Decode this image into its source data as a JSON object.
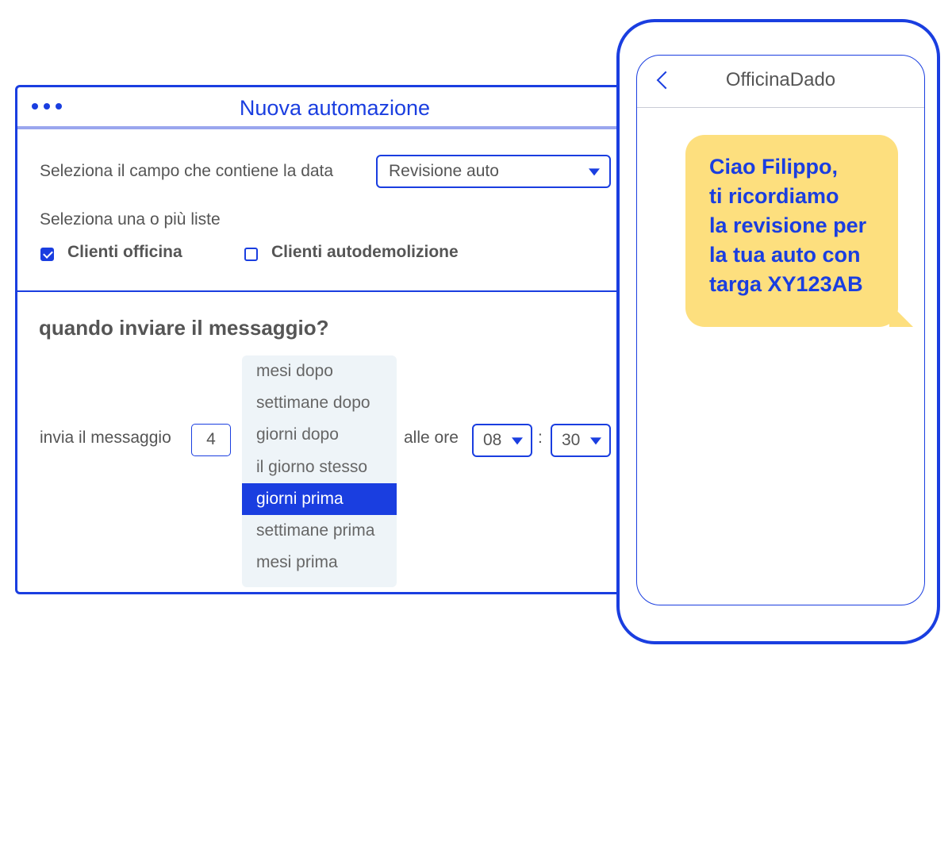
{
  "window": {
    "title": "Nuova automazione",
    "date_field_label": "Seleziona il campo che contiene la data",
    "date_field_value": "Revisione auto",
    "lists_label": "Seleziona una o più liste",
    "lists": [
      {
        "label": "Clienti officina",
        "checked": true
      },
      {
        "label": "Clienti autodemolizione",
        "checked": false
      }
    ],
    "section_title": "quando inviare il messaggio?",
    "send_label": "invia il messaggio",
    "send_amount": "4",
    "timing_options": [
      "mesi dopo",
      "settimane dopo",
      "giorni dopo",
      "il giorno stesso",
      "giorni prima",
      "settimane prima",
      "mesi prima"
    ],
    "timing_selected": "giorni prima",
    "time_label": "alle ore",
    "hour": "08",
    "separator": ":",
    "minute": "30"
  },
  "phone": {
    "sender": "OfficinaDado",
    "message_lines": [
      "Ciao Filippo,",
      "ti ricordiamo",
      "la revisione per",
      "la tua auto con",
      "targa XY123AB"
    ]
  },
  "colors": {
    "accent": "#1a3ee0",
    "bubble": "#fddf7e",
    "dropdown_bg": "#eef4f8"
  }
}
